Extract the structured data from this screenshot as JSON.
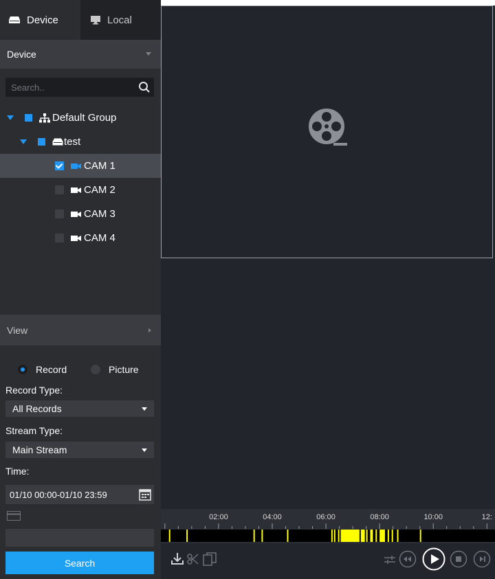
{
  "tabs": [
    {
      "label": "Device",
      "icon": "device-icon",
      "active": true
    },
    {
      "label": "Local",
      "icon": "monitor-icon",
      "active": false
    }
  ],
  "device_panel": {
    "header": "Device",
    "search_placeholder": "Search..",
    "tree": {
      "group": {
        "label": "Default Group",
        "icon": "org-chart-icon",
        "expanded": true
      },
      "device": {
        "label": "test",
        "icon": "dvr-icon",
        "expanded": true
      },
      "cameras": [
        {
          "label": "CAM 1",
          "checked": true,
          "selected": true
        },
        {
          "label": "CAM 2",
          "checked": false,
          "selected": false
        },
        {
          "label": "CAM 3",
          "checked": false,
          "selected": false
        },
        {
          "label": "CAM 4",
          "checked": false,
          "selected": false
        }
      ]
    }
  },
  "view_panel": {
    "header": "View"
  },
  "search_form": {
    "mode_options": [
      {
        "label": "Record",
        "selected": true
      },
      {
        "label": "Picture",
        "selected": false
      }
    ],
    "record_type_label": "Record Type:",
    "record_type_value": "All Records",
    "stream_type_label": "Stream Type:",
    "stream_type_value": "Main Stream",
    "time_label": "Time:",
    "time_value": "01/10 00:00-01/10 23:59",
    "search_button": "Search"
  },
  "player": {
    "placeholder_icon": "film-reel-icon"
  },
  "timeline": {
    "tick_labels": [
      "02:00",
      "04:00",
      "06:00",
      "08:00",
      "10:00",
      "12:"
    ],
    "tick_hours": [
      2,
      4,
      6,
      8,
      10,
      12
    ],
    "visible_hours": [
      -0.15,
      12.3
    ],
    "record_color": "#ffff00",
    "record_segments": [
      [
        0.15,
        0.19
      ],
      [
        0.8,
        0.84
      ],
      [
        3.3,
        3.34
      ],
      [
        3.6,
        3.64
      ],
      [
        4.55,
        4.6
      ],
      [
        6.2,
        6.25
      ],
      [
        6.3,
        6.35
      ],
      [
        6.45,
        6.5
      ],
      [
        6.55,
        7.25
      ],
      [
        7.3,
        7.45
      ],
      [
        7.5,
        7.55
      ],
      [
        7.65,
        7.75
      ],
      [
        7.85,
        7.9
      ],
      [
        8.0,
        8.2
      ],
      [
        8.3,
        8.35
      ],
      [
        8.45,
        8.5
      ],
      [
        8.65,
        8.7
      ],
      [
        9.5,
        9.55
      ]
    ]
  },
  "toolbar": {
    "left_icons": [
      "download-icon",
      "scissors-icon",
      "snapshot-icon"
    ],
    "right_icons": [
      "sync-icon",
      "rewind-icon",
      "play-icon",
      "stop-icon",
      "next-frame-icon"
    ]
  },
  "colors": {
    "accent": "#2196f3",
    "button": "#1ea1f3",
    "sidebar_bg": "#2b2d31",
    "main_bg": "#22252b"
  }
}
